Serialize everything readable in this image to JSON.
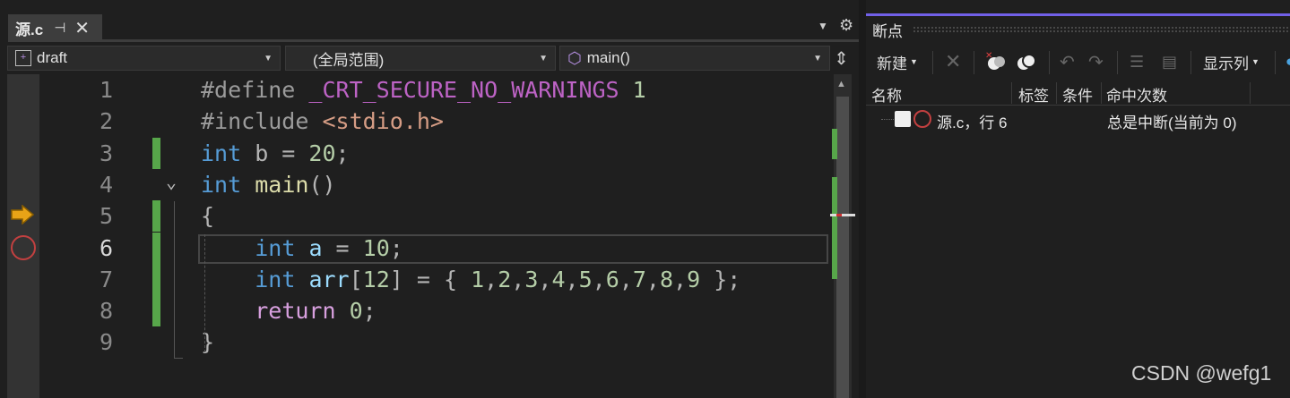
{
  "editor": {
    "tab": {
      "title": "源.c",
      "pin_icon": "pin-icon",
      "close_icon": "close-icon"
    },
    "nav": {
      "project": "draft",
      "scope": "(全局范围)",
      "function": "main()"
    },
    "lines": [
      {
        "num": "1",
        "tokens": [
          {
            "t": "#define ",
            "c": "pp"
          },
          {
            "t": "_CRT_SECURE_NO_WARNINGS",
            "c": "mac"
          },
          {
            "t": " 1",
            "c": "num"
          }
        ]
      },
      {
        "num": "2",
        "tokens": [
          {
            "t": "#include ",
            "c": "pp"
          },
          {
            "t": "<stdio.h>",
            "c": "str"
          }
        ]
      },
      {
        "num": "3",
        "tokens": [
          {
            "t": "int",
            "c": "kw"
          },
          {
            "t": " b = ",
            "c": "op"
          },
          {
            "t": "20",
            "c": "num"
          },
          {
            "t": ";",
            "c": "op"
          }
        ]
      },
      {
        "num": "4",
        "tokens": [
          {
            "t": "int",
            "c": "kw"
          },
          {
            "t": " ",
            "c": "op"
          },
          {
            "t": "main",
            "c": "fn"
          },
          {
            "t": "()",
            "c": "op"
          }
        ]
      },
      {
        "num": "5",
        "tokens": [
          {
            "t": "{",
            "c": "op"
          }
        ]
      },
      {
        "num": "6",
        "tokens": [
          {
            "t": "    ",
            "c": "op"
          },
          {
            "t": "int",
            "c": "kw"
          },
          {
            "t": " ",
            "c": "op"
          },
          {
            "t": "a",
            "c": "id"
          },
          {
            "t": " = ",
            "c": "op"
          },
          {
            "t": "10",
            "c": "num"
          },
          {
            "t": ";",
            "c": "op"
          }
        ]
      },
      {
        "num": "7",
        "tokens": [
          {
            "t": "    ",
            "c": "op"
          },
          {
            "t": "int",
            "c": "kw"
          },
          {
            "t": " ",
            "c": "op"
          },
          {
            "t": "arr",
            "c": "id"
          },
          {
            "t": "[",
            "c": "op"
          },
          {
            "t": "12",
            "c": "num"
          },
          {
            "t": "] = { ",
            "c": "op"
          },
          {
            "t": "1",
            "c": "num"
          },
          {
            "t": ",",
            "c": "op"
          },
          {
            "t": "2",
            "c": "num"
          },
          {
            "t": ",",
            "c": "op"
          },
          {
            "t": "3",
            "c": "num"
          },
          {
            "t": ",",
            "c": "op"
          },
          {
            "t": "4",
            "c": "num"
          },
          {
            "t": ",",
            "c": "op"
          },
          {
            "t": "5",
            "c": "num"
          },
          {
            "t": ",",
            "c": "op"
          },
          {
            "t": "6",
            "c": "num"
          },
          {
            "t": ",",
            "c": "op"
          },
          {
            "t": "7",
            "c": "num"
          },
          {
            "t": ",",
            "c": "op"
          },
          {
            "t": "8",
            "c": "num"
          },
          {
            "t": ",",
            "c": "op"
          },
          {
            "t": "9",
            "c": "num"
          },
          {
            "t": " };",
            "c": "op"
          }
        ]
      },
      {
        "num": "8",
        "tokens": [
          {
            "t": "    ",
            "c": "op"
          },
          {
            "t": "return",
            "c": "ret"
          },
          {
            "t": " ",
            "c": "op"
          },
          {
            "t": "0",
            "c": "num"
          },
          {
            "t": ";",
            "c": "op"
          }
        ]
      },
      {
        "num": "9",
        "tokens": [
          {
            "t": "}",
            "c": "op"
          }
        ]
      }
    ],
    "active_line": "6",
    "changed_lines": [
      "3",
      "5",
      "6",
      "7",
      "8"
    ]
  },
  "breakpoints": {
    "title": "断点",
    "toolbar": {
      "new_label": "新建",
      "columns_label": "显示列"
    },
    "columns": [
      "名称",
      "标签",
      "条件",
      "命中次数"
    ],
    "rows": [
      {
        "name": "源.c，行 6",
        "hit_count": "总是中断(当前为 0)",
        "enabled": false
      }
    ]
  },
  "watermark": "CSDN @wefg1",
  "colors": {
    "accent": "#7160e8",
    "change_bar": "#57a64a",
    "breakpoint": "#c24040",
    "current_arrow": "#e8a317"
  }
}
